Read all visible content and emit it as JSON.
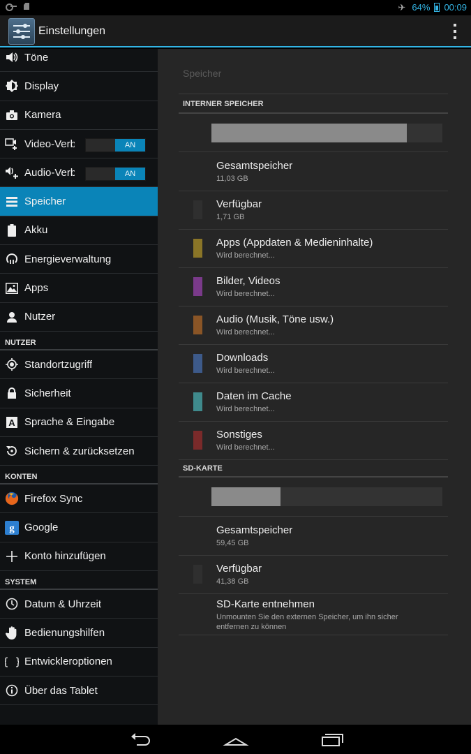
{
  "status": {
    "battery_percent": "64%",
    "time": "00:09",
    "accent": "#33b5e5"
  },
  "actionbar": {
    "title": "Einstellungen",
    "icon": "settings-sliders-icon"
  },
  "sidebar": {
    "items": [
      {
        "label": "Töne",
        "icon": "speaker-icon"
      },
      {
        "label": "Display",
        "icon": "brightness-icon"
      },
      {
        "label": "Kamera",
        "icon": "camera-icon"
      },
      {
        "label": "Video-Verb",
        "icon": "video-call-icon",
        "toggle": "AN"
      },
      {
        "label": "Audio-Verb",
        "icon": "audio-call-icon",
        "toggle": "AN"
      },
      {
        "label": "Speicher",
        "icon": "storage-icon",
        "selected": true
      },
      {
        "label": "Akku",
        "icon": "battery-icon"
      },
      {
        "label": "Energieverwaltung",
        "icon": "power-management-icon"
      },
      {
        "label": "Apps",
        "icon": "apps-icon"
      },
      {
        "label": "Nutzer",
        "icon": "user-icon"
      }
    ],
    "section_nutzer": "NUTZER",
    "nutzer_items": [
      {
        "label": "Standortzugriff",
        "icon": "location-icon"
      },
      {
        "label": "Sicherheit",
        "icon": "lock-icon"
      },
      {
        "label": "Sprache & Eingabe",
        "icon": "language-icon"
      },
      {
        "label": "Sichern & zurücksetzen",
        "icon": "backup-icon"
      }
    ],
    "section_konten": "KONTEN",
    "konten_items": [
      {
        "label": "Firefox Sync",
        "icon": "firefox-icon"
      },
      {
        "label": "Google",
        "icon": "google-icon"
      },
      {
        "label": "Konto hinzufügen",
        "icon": "plus-icon"
      }
    ],
    "section_system": "SYSTEM",
    "system_items": [
      {
        "label": "Datum & Uhrzeit",
        "icon": "clock-icon"
      },
      {
        "label": "Bedienungshilfen",
        "icon": "hand-icon"
      },
      {
        "label": "Entwickleroptionen",
        "icon": "braces-icon"
      },
      {
        "label": "Über das Tablet",
        "icon": "info-icon"
      }
    ]
  },
  "main": {
    "title": "Speicher",
    "internal": {
      "header": "INTERNER SPEICHER",
      "used_fraction": 0.845,
      "rows": [
        {
          "title": "Gesamtspeicher",
          "sub": "11,03 GB",
          "color": ""
        },
        {
          "title": "Verfügbar",
          "sub": "1,71 GB",
          "color": "#2f2f2f"
        },
        {
          "title": "Apps (Appdaten & Medieninhalte)",
          "sub": "Wird berechnet...",
          "color": "#8a7527"
        },
        {
          "title": "Bilder, Videos",
          "sub": "Wird berechnet...",
          "color": "#7a3a8a"
        },
        {
          "title": "Audio (Musik, Töne usw.)",
          "sub": "Wird berechnet...",
          "color": "#8a5526"
        },
        {
          "title": "Downloads",
          "sub": "Wird berechnet...",
          "color": "#3d5a8a"
        },
        {
          "title": "Daten im Cache",
          "sub": "Wird berechnet...",
          "color": "#3f8a8c"
        },
        {
          "title": "Sonstiges",
          "sub": "Wird berechnet...",
          "color": "#7a2a2a"
        }
      ]
    },
    "sd": {
      "header": "SD-KARTE",
      "used_fraction": 0.3,
      "rows": [
        {
          "title": "Gesamtspeicher",
          "sub": "59,45 GB",
          "color": ""
        },
        {
          "title": "Verfügbar",
          "sub": "41,38 GB",
          "color": "#2f2f2f"
        }
      ],
      "unmount": {
        "title": "SD-Karte entnehmen",
        "sub": "Unmounten Sie den externen Speicher, um ihn sicher entfernen zu können"
      }
    }
  },
  "navbar": {
    "back": "back-icon",
    "home": "home-icon",
    "recent": "recent-apps-icon"
  }
}
